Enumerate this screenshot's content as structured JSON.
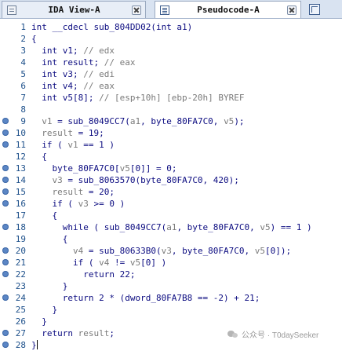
{
  "tabs": [
    {
      "label": "IDA View-A",
      "active": false,
      "icon": "ida-view-icon"
    },
    {
      "label": "Pseudocode-A",
      "active": true,
      "icon": "pseudocode-icon"
    },
    {
      "label": "",
      "active": false,
      "icon": "hex-view-icon"
    }
  ],
  "code_lines": [
    {
      "n": "1",
      "bp": false,
      "seg": [
        [
          "int __cdecl sub_804DD02(int a1)",
          "n"
        ]
      ]
    },
    {
      "n": "2",
      "bp": false,
      "seg": [
        [
          "{",
          "n"
        ]
      ]
    },
    {
      "n": "3",
      "bp": false,
      "seg": [
        [
          "  int v1; ",
          "n"
        ],
        [
          "// edx",
          "c"
        ]
      ]
    },
    {
      "n": "4",
      "bp": false,
      "seg": [
        [
          "  int result; ",
          "n"
        ],
        [
          "// eax",
          "c"
        ]
      ]
    },
    {
      "n": "5",
      "bp": false,
      "seg": [
        [
          "  int v3; ",
          "n"
        ],
        [
          "// edi",
          "c"
        ]
      ]
    },
    {
      "n": "6",
      "bp": false,
      "seg": [
        [
          "  int v4; ",
          "n"
        ],
        [
          "// eax",
          "c"
        ]
      ]
    },
    {
      "n": "7",
      "bp": false,
      "seg": [
        [
          "  int v5[8]; ",
          "n"
        ],
        [
          "// [esp+10h] [ebp-20h] BYREF",
          "c"
        ]
      ]
    },
    {
      "n": "8",
      "bp": false,
      "seg": [
        [
          "",
          "n"
        ]
      ]
    },
    {
      "n": "9",
      "bp": true,
      "seg": [
        [
          "  ",
          "n"
        ],
        [
          "v1",
          "g"
        ],
        [
          " = sub_8049CC7(",
          "n"
        ],
        [
          "a1",
          "g"
        ],
        [
          ", byte_80FA7C0, ",
          "n"
        ],
        [
          "v5",
          "g"
        ],
        [
          ");",
          "n"
        ]
      ]
    },
    {
      "n": "10",
      "bp": true,
      "seg": [
        [
          "  ",
          "n"
        ],
        [
          "result",
          "g"
        ],
        [
          " = 19;",
          "n"
        ]
      ]
    },
    {
      "n": "11",
      "bp": true,
      "seg": [
        [
          "  if ( ",
          "n"
        ],
        [
          "v1",
          "g"
        ],
        [
          " == 1 )",
          "n"
        ]
      ]
    },
    {
      "n": "12",
      "bp": false,
      "seg": [
        [
          "  {",
          "n"
        ]
      ]
    },
    {
      "n": "13",
      "bp": true,
      "seg": [
        [
          "    byte_80FA7C0[",
          "n"
        ],
        [
          "v5",
          "g"
        ],
        [
          "[0]] = 0;",
          "n"
        ]
      ]
    },
    {
      "n": "14",
      "bp": true,
      "seg": [
        [
          "    ",
          "n"
        ],
        [
          "v3",
          "g"
        ],
        [
          " = sub_8063570(byte_80FA7C0, 420);",
          "n"
        ]
      ]
    },
    {
      "n": "15",
      "bp": true,
      "seg": [
        [
          "    ",
          "n"
        ],
        [
          "result",
          "g"
        ],
        [
          " = 20;",
          "n"
        ]
      ]
    },
    {
      "n": "16",
      "bp": true,
      "seg": [
        [
          "    if ( ",
          "n"
        ],
        [
          "v3",
          "g"
        ],
        [
          " >= 0 )",
          "n"
        ]
      ]
    },
    {
      "n": "17",
      "bp": false,
      "seg": [
        [
          "    {",
          "n"
        ]
      ]
    },
    {
      "n": "18",
      "bp": true,
      "seg": [
        [
          "      while ( sub_8049CC7(",
          "n"
        ],
        [
          "a1",
          "g"
        ],
        [
          ", byte_80FA7C0, ",
          "n"
        ],
        [
          "v5",
          "g"
        ],
        [
          ") == 1 )",
          "n"
        ]
      ]
    },
    {
      "n": "19",
      "bp": false,
      "seg": [
        [
          "      {",
          "n"
        ]
      ]
    },
    {
      "n": "20",
      "bp": true,
      "seg": [
        [
          "        ",
          "n"
        ],
        [
          "v4",
          "g"
        ],
        [
          " = sub_80633B0(",
          "n"
        ],
        [
          "v3",
          "g"
        ],
        [
          ", byte_80FA7C0, ",
          "n"
        ],
        [
          "v5",
          "g"
        ],
        [
          "[0]);",
          "n"
        ]
      ]
    },
    {
      "n": "21",
      "bp": true,
      "seg": [
        [
          "        if ( ",
          "n"
        ],
        [
          "v4",
          "g"
        ],
        [
          " != ",
          "n"
        ],
        [
          "v5",
          "g"
        ],
        [
          "[0] )",
          "n"
        ]
      ]
    },
    {
      "n": "22",
      "bp": true,
      "seg": [
        [
          "          return 22;",
          "n"
        ]
      ]
    },
    {
      "n": "23",
      "bp": false,
      "seg": [
        [
          "      }",
          "n"
        ]
      ]
    },
    {
      "n": "24",
      "bp": true,
      "seg": [
        [
          "      return 2 * (dword_80FA7B8 == -2) + 21;",
          "n"
        ]
      ]
    },
    {
      "n": "25",
      "bp": false,
      "seg": [
        [
          "    }",
          "n"
        ]
      ]
    },
    {
      "n": "26",
      "bp": false,
      "seg": [
        [
          "  }",
          "n"
        ]
      ]
    },
    {
      "n": "27",
      "bp": true,
      "seg": [
        [
          "  return ",
          "n"
        ],
        [
          "result",
          "g"
        ],
        [
          ";",
          "n"
        ]
      ]
    },
    {
      "n": "28",
      "bp": true,
      "seg": [
        [
          "}",
          "n"
        ]
      ]
    }
  ],
  "watermark": "公众号 · T0daySeeker",
  "colors": {
    "code": "#0b0b80",
    "comment": "#7a7a7a",
    "line_number": "#1c4f8a",
    "breakpoint": "#5b86c5"
  }
}
